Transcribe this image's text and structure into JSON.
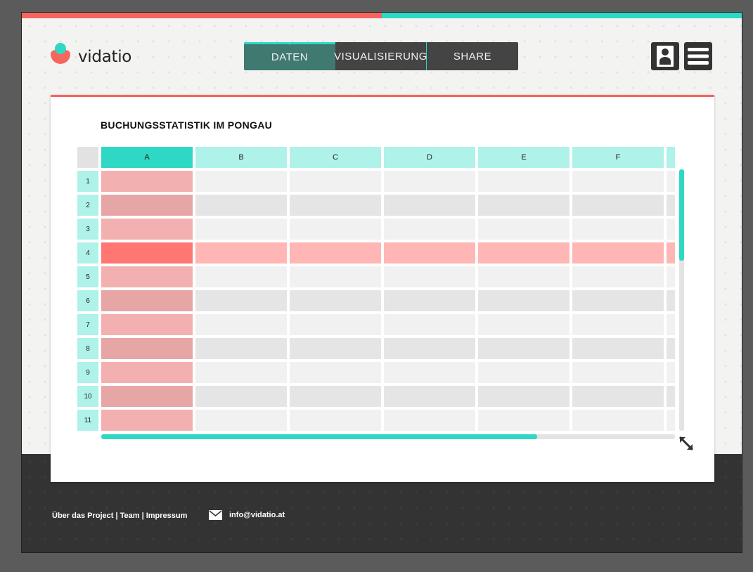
{
  "app": {
    "logo_text": "vidatio"
  },
  "nav": {
    "tabs": [
      {
        "label": "DATEN",
        "active": true
      },
      {
        "label": "VISUALISIERUNG"
      },
      {
        "label": "SHARE"
      }
    ]
  },
  "header_icons": {
    "user": "user-icon",
    "menu": "hamburger-menu-icon"
  },
  "table": {
    "title": "BUCHUNGSSTATISTIK IM PONGAU",
    "columns": [
      "A",
      "B",
      "C",
      "D",
      "E",
      "F"
    ],
    "rows": [
      "1",
      "2",
      "3",
      "4",
      "5",
      "6",
      "7",
      "8",
      "9",
      "10",
      "11"
    ],
    "selected_column": "A",
    "selected_row": "4",
    "vertical_scroll_fraction": 0.35,
    "horizontal_scroll_fraction": 0.76
  },
  "footer": {
    "links": "Über das Project | Team | Impressum",
    "email": "info@vidatio.at",
    "email_icon": "mail-icon"
  },
  "colors": {
    "accent_teal": "#2fd8c4",
    "accent_red": "#f5665f",
    "dark": "#333333"
  }
}
